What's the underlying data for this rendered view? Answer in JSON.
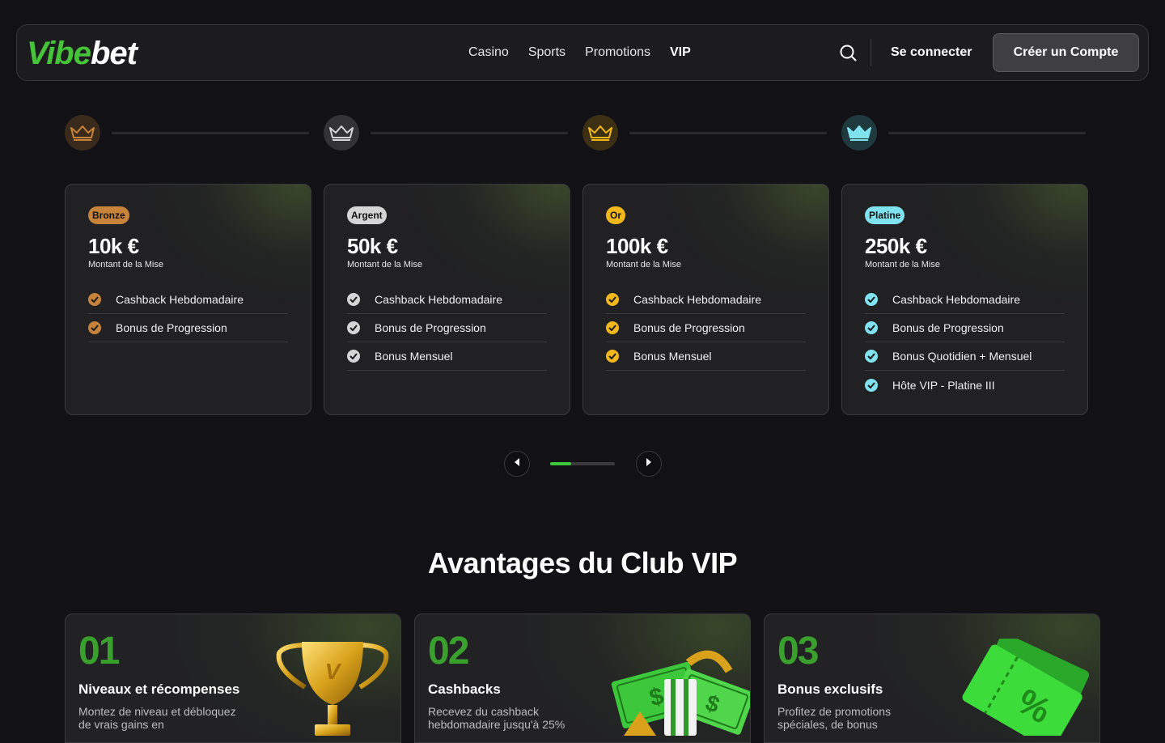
{
  "header": {
    "logo": {
      "part1": "Vibe",
      "part2": "bet"
    },
    "nav": [
      "Casino",
      "Sports",
      "Promotions",
      "VIP"
    ],
    "active_nav": "VIP",
    "login_label": "Se connecter",
    "signup_label": "Créer un Compte"
  },
  "tiers": [
    {
      "badge": "Bronze",
      "color": "#c8833a",
      "amount": "10k €",
      "amount_label": "Montant de la Mise",
      "features": [
        "Cashback Hebdomadaire",
        "Bonus de Progression"
      ]
    },
    {
      "badge": "Argent",
      "color": "#d5d5d5",
      "amount": "50k €",
      "amount_label": "Montant de la Mise",
      "features": [
        "Cashback Hebdomadaire",
        "Bonus de Progression",
        "Bonus Mensuel"
      ]
    },
    {
      "badge": "Or",
      "color": "#f2b71b",
      "amount": "100k €",
      "amount_label": "Montant de la Mise",
      "features": [
        "Cashback Hebdomadaire",
        "Bonus de Progression",
        "Bonus Mensuel"
      ]
    },
    {
      "badge": "Platine",
      "color": "#7fe3ef",
      "amount": "250k €",
      "amount_label": "Montant de la Mise",
      "features": [
        "Cashback Hebdomadaire",
        "Bonus de Progression",
        "Bonus Quotidien + Mensuel",
        "Hôte VIP - Platine III"
      ]
    }
  ],
  "carousel": {
    "progress": 0.33
  },
  "benefits": {
    "title": "Avantages du Club VIP",
    "items": [
      {
        "num": "01",
        "title": "Niveaux et récompenses",
        "desc": "Montez de niveau et débloquez de vrais gains en"
      },
      {
        "num": "02",
        "title": "Cashbacks",
        "desc": "Recevez du cashback hebdomadaire jusqu'à 25%"
      },
      {
        "num": "03",
        "title": "Bonus exclusifs",
        "desc": "Profitez de promotions spéciales, de bonus"
      }
    ]
  },
  "colors": {
    "brand_green": "#45c43a",
    "accent_green": "#3aa02d",
    "bg": "#121216"
  },
  "icons": [
    "search-icon",
    "crown-icon",
    "check-icon",
    "arrow-left-icon",
    "arrow-right-icon",
    "trophy-icon",
    "money-icon",
    "ticket-icon"
  ]
}
